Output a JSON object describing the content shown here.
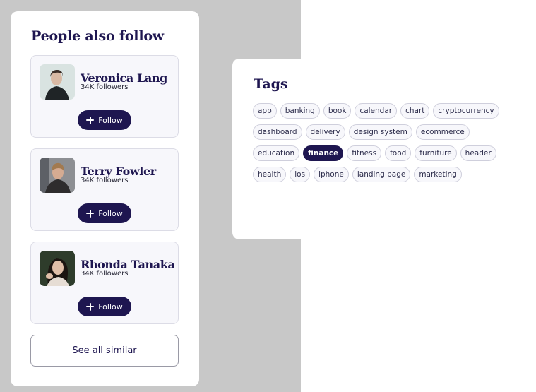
{
  "people_panel": {
    "title": "People also follow",
    "people": [
      {
        "name": "Veronica Lang",
        "followers": "34K followers",
        "follow_label": "Follow"
      },
      {
        "name": "Terry Fowler",
        "followers": "34K followers",
        "follow_label": "Follow"
      },
      {
        "name": "Rhonda Tanaka",
        "followers": "34K followers",
        "follow_label": "Follow"
      }
    ],
    "see_all_label": "See all similar"
  },
  "tags_panel": {
    "title": "Tags",
    "tags": [
      "app",
      "banking",
      "book",
      "calendar",
      "chart",
      "cryptocurrency",
      "dashboard",
      "delivery",
      "design system",
      "ecommerce",
      "education",
      "finance",
      "fitness",
      "food",
      "furniture",
      "header",
      "health",
      "ios",
      "iphone",
      "landing page",
      "marketing"
    ],
    "active_tag": "finance"
  },
  "colors": {
    "primary": "#1e1650",
    "backdrop": "#c8c8c8",
    "card_bg": "#f7f7fb"
  },
  "icons": {
    "follow_button_icon": "plus-icon",
    "avatars": [
      "avatar-photo",
      "avatar-photo",
      "avatar-photo"
    ]
  }
}
